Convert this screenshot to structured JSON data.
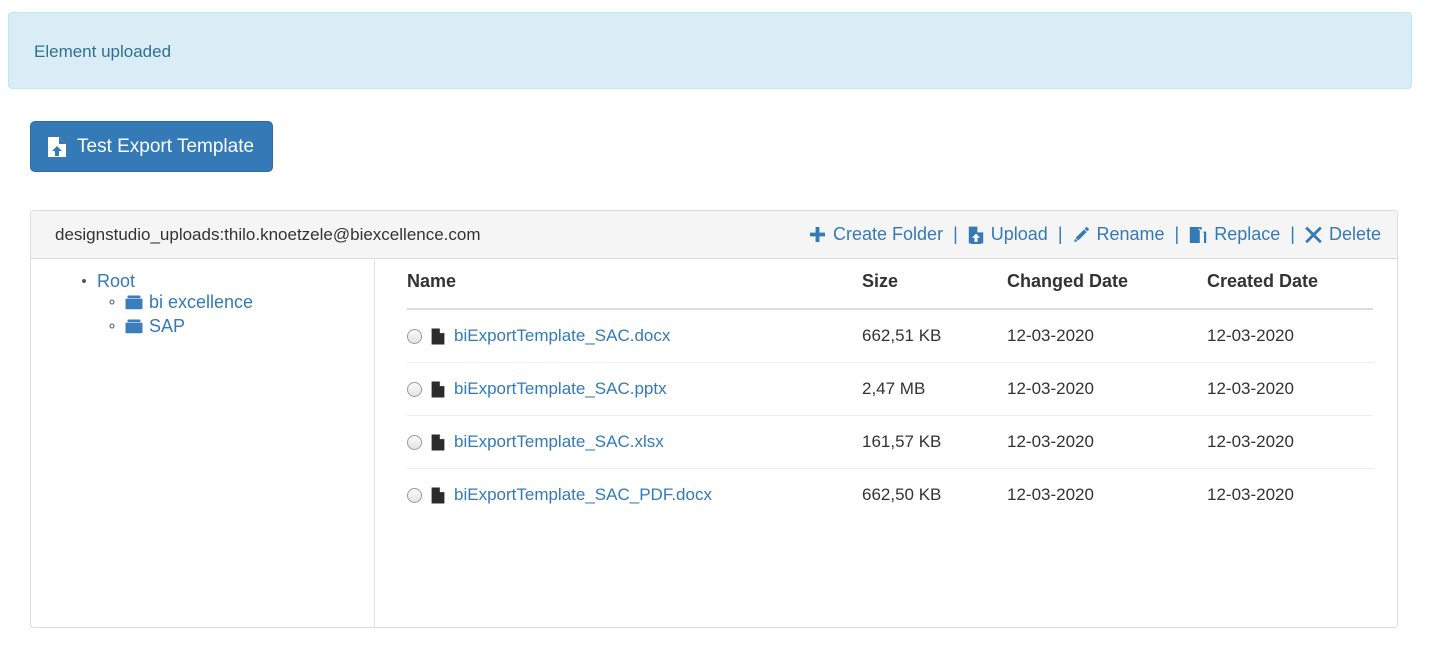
{
  "alert": {
    "message": "Element uploaded",
    "bg_color": "#d9edf7",
    "border_color": "#bce8f1",
    "text_color": "#31708f"
  },
  "primary_button": {
    "label": "Test Export Template",
    "icon": "file-upload-icon",
    "bg_color": "#337ab7"
  },
  "panel": {
    "path": "designstudio_uploads:thilo.knoetzele@biexcellence.com",
    "actions": [
      {
        "label": "Create Folder",
        "icon": "plus-icon"
      },
      {
        "label": "Upload",
        "icon": "file-upload-icon"
      },
      {
        "label": "Rename",
        "icon": "pencil-icon"
      },
      {
        "label": "Replace",
        "icon": "copy-files-icon"
      },
      {
        "label": "Delete",
        "icon": "cross-icon"
      }
    ],
    "separator": "|",
    "link_color": "#337ab7"
  },
  "tree": {
    "root": {
      "label": "Root"
    },
    "children": [
      {
        "label": "bi excellence",
        "icon": "folder-icon"
      },
      {
        "label": "SAP",
        "icon": "folder-icon"
      }
    ]
  },
  "table": {
    "headers": [
      "Name",
      "Size",
      "Changed Date",
      "Created Date"
    ],
    "rows": [
      {
        "name": "biExportTemplate_SAC.docx",
        "size": "662,51 KB",
        "changed": "12-03-2020",
        "created": "12-03-2020",
        "icon": "file-icon",
        "selected": false
      },
      {
        "name": "biExportTemplate_SAC.pptx",
        "size": "2,47 MB",
        "changed": "12-03-2020",
        "created": "12-03-2020",
        "icon": "file-icon",
        "selected": false
      },
      {
        "name": "biExportTemplate_SAC.xlsx",
        "size": "161,57 KB",
        "changed": "12-03-2020",
        "created": "12-03-2020",
        "icon": "file-icon",
        "selected": false
      },
      {
        "name": "biExportTemplate_SAC_PDF.docx",
        "size": "662,50 KB",
        "changed": "12-03-2020",
        "created": "12-03-2020",
        "icon": "file-icon",
        "selected": false
      }
    ]
  }
}
